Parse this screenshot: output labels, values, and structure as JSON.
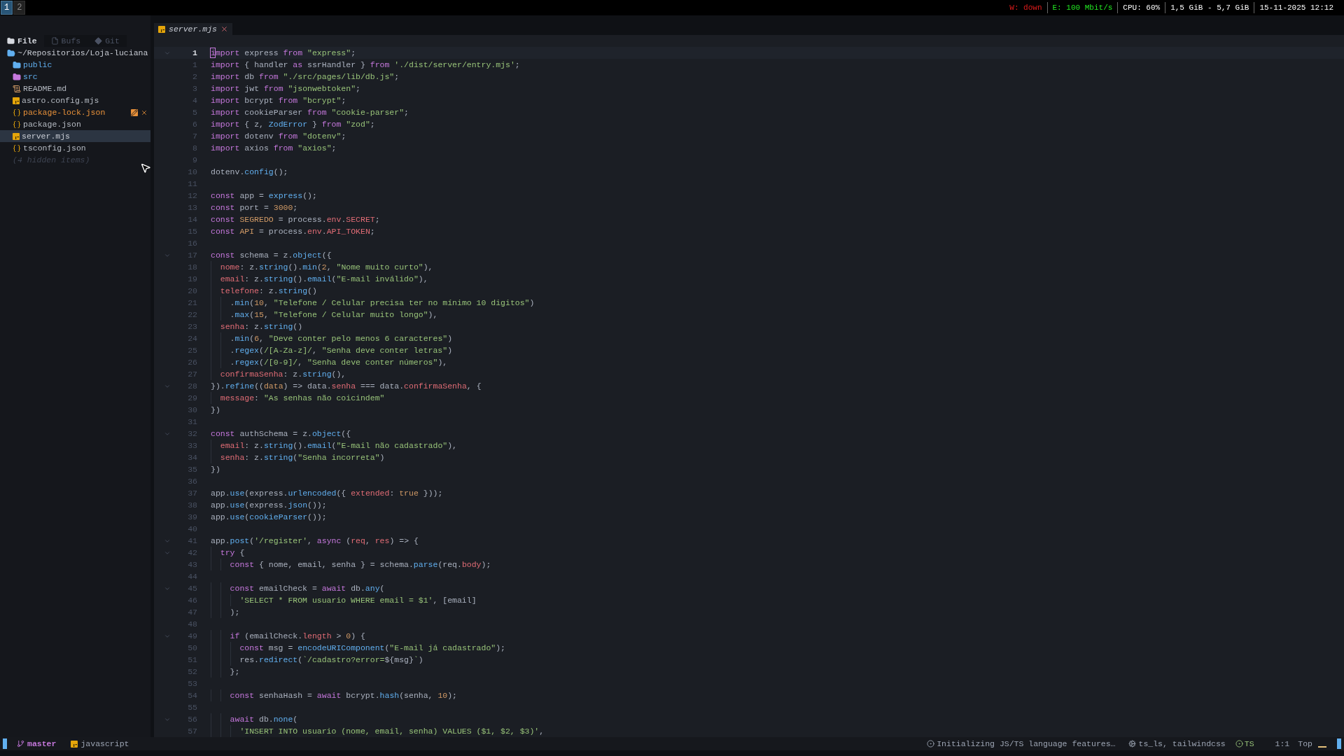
{
  "workspaces": [
    {
      "label": "1",
      "selected": true
    },
    {
      "label": "2",
      "selected": false
    }
  ],
  "system_status": [
    {
      "text": "W: down",
      "color": "#e01b1b"
    },
    {
      "text": "E: 100 Mbit/s",
      "color": "#22e622"
    },
    {
      "text": "CPU: 60%",
      "color": "#ffffff"
    },
    {
      "text": "1,5 GiB - 5,7 GiB",
      "color": "#ffffff"
    },
    {
      "text": "15-11-2025 12:12",
      "color": "#ffffff"
    }
  ],
  "sidebar": {
    "tabs": [
      {
        "label": "File",
        "kind": "folder",
        "selected": true
      },
      {
        "label": "Bufs",
        "kind": "file",
        "selected": false
      },
      {
        "label": "Git",
        "kind": "git",
        "selected": false
      }
    ],
    "tree": [
      {
        "label": "~/Repositorios/Loja-luciana",
        "kind": "root",
        "selected": false,
        "modified": false,
        "children": [
          {
            "label": "public",
            "kind": "folder",
            "selected": false,
            "modified": false
          },
          {
            "label": "src",
            "kind": "src_folder",
            "selected": false,
            "modified": false
          },
          {
            "label": "README.md",
            "kind": "markdown",
            "selected": false,
            "modified": false
          },
          {
            "label": "astro.config.mjs",
            "kind": "js",
            "selected": false,
            "modified": false
          },
          {
            "label": "package-lock.json",
            "kind": "json",
            "selected": false,
            "modified": true
          },
          {
            "label": "package.json",
            "kind": "json",
            "selected": false,
            "modified": false
          },
          {
            "label": "server.mjs",
            "kind": "js",
            "selected": true,
            "modified": false
          },
          {
            "label": "tsconfig.json",
            "kind": "json",
            "selected": false,
            "modified": false
          }
        ]
      }
    ],
    "hidden_note": "(4 hidden items)"
  },
  "editor_tabs": [
    {
      "label": "server.mjs",
      "selected": true
    }
  ],
  "lines": [
    {
      "num": "1",
      "fold": true,
      "current": true,
      "tokens": [
        {
          "kind": "keyword",
          "text": "import"
        },
        {
          "kind": "plain",
          "text": " express "
        },
        {
          "kind": "keyword",
          "text": "from"
        },
        {
          "kind": "string",
          "text": " \"express\""
        },
        {
          "kind": "plain",
          "text": ";"
        }
      ]
    },
    {
      "num": "1",
      "fold": false,
      "current": false,
      "tokens": [
        {
          "kind": "keyword",
          "text": "import"
        },
        {
          "kind": "plain",
          "text": " { handler "
        },
        {
          "kind": "keyword",
          "text": "as"
        },
        {
          "kind": "plain",
          "text": " ssrHandler } "
        },
        {
          "kind": "keyword",
          "text": "from"
        },
        {
          "kind": "string",
          "text": " './dist/server/entry.mjs'"
        },
        {
          "kind": "plain",
          "text": ";"
        }
      ]
    },
    {
      "num": "2",
      "fold": false,
      "current": false,
      "tokens": [
        {
          "kind": "keyword",
          "text": "import"
        },
        {
          "kind": "plain",
          "text": " db "
        },
        {
          "kind": "keyword",
          "text": "from"
        },
        {
          "kind": "string",
          "text": " \"./src/pages/lib/db.js\""
        },
        {
          "kind": "plain",
          "text": ";"
        }
      ]
    },
    {
      "num": "3",
      "fold": false,
      "current": false,
      "tokens": [
        {
          "kind": "keyword",
          "text": "import"
        },
        {
          "kind": "plain",
          "text": " jwt "
        },
        {
          "kind": "keyword",
          "text": "from"
        },
        {
          "kind": "string",
          "text": " \"jsonwebtoken\""
        },
        {
          "kind": "plain",
          "text": ";"
        }
      ]
    },
    {
      "num": "4",
      "fold": false,
      "current": false,
      "tokens": [
        {
          "kind": "keyword",
          "text": "import"
        },
        {
          "kind": "plain",
          "text": " bcrypt "
        },
        {
          "kind": "keyword",
          "text": "from"
        },
        {
          "kind": "string",
          "text": " \"bcrypt\""
        },
        {
          "kind": "plain",
          "text": ";"
        }
      ]
    },
    {
      "num": "5",
      "fold": false,
      "current": false,
      "tokens": [
        {
          "kind": "keyword",
          "text": "import"
        },
        {
          "kind": "plain",
          "text": " cookieParser "
        },
        {
          "kind": "keyword",
          "text": "from"
        },
        {
          "kind": "string",
          "text": " \"cookie-parser\""
        },
        {
          "kind": "plain",
          "text": ";"
        }
      ]
    },
    {
      "num": "6",
      "fold": false,
      "current": false,
      "tokens": [
        {
          "kind": "keyword",
          "text": "import"
        },
        {
          "kind": "plain",
          "text": " { z, "
        },
        {
          "kind": "type",
          "text": "ZodError"
        },
        {
          "kind": "plain",
          "text": " } "
        },
        {
          "kind": "keyword",
          "text": "from"
        },
        {
          "kind": "string",
          "text": " \"zod\""
        },
        {
          "kind": "plain",
          "text": ";"
        }
      ]
    },
    {
      "num": "7",
      "fold": false,
      "current": false,
      "tokens": [
        {
          "kind": "keyword",
          "text": "import"
        },
        {
          "kind": "plain",
          "text": " dotenv "
        },
        {
          "kind": "keyword",
          "text": "from"
        },
        {
          "kind": "string",
          "text": " \"dotenv\""
        },
        {
          "kind": "plain",
          "text": ";"
        }
      ]
    },
    {
      "num": "8",
      "fold": false,
      "current": false,
      "tokens": [
        {
          "kind": "keyword",
          "text": "import"
        },
        {
          "kind": "plain",
          "text": " axios "
        },
        {
          "kind": "keyword",
          "text": "from"
        },
        {
          "kind": "string",
          "text": " \"axios\""
        },
        {
          "kind": "plain",
          "text": ";"
        }
      ]
    },
    {
      "num": "9",
      "fold": false,
      "current": false
    },
    {
      "num": "10",
      "fold": false,
      "current": false,
      "tokens": [
        {
          "kind": "plain",
          "text": "dotenv."
        },
        {
          "kind": "function",
          "text": "config"
        },
        {
          "kind": "plain",
          "text": "();"
        }
      ]
    },
    {
      "num": "11",
      "fold": false,
      "current": false
    },
    {
      "num": "12",
      "fold": false,
      "current": false,
      "tokens": [
        {
          "kind": "keyword",
          "text": "const"
        },
        {
          "kind": "plain",
          "text": " app = "
        },
        {
          "kind": "function",
          "text": "express"
        },
        {
          "kind": "plain",
          "text": "();"
        }
      ]
    },
    {
      "num": "13",
      "fold": false,
      "current": false,
      "tokens": [
        {
          "kind": "keyword",
          "text": "const"
        },
        {
          "kind": "plain",
          "text": " port = "
        },
        {
          "kind": "number",
          "text": "3000"
        },
        {
          "kind": "plain",
          "text": ";"
        }
      ]
    },
    {
      "num": "14",
      "fold": false,
      "current": false,
      "tokens": [
        {
          "kind": "keyword",
          "text": "const"
        },
        {
          "kind": "number",
          "text": " SEGREDO"
        },
        {
          "kind": "plain",
          "text": " = process."
        },
        {
          "kind": "property",
          "text": "env"
        },
        {
          "kind": "plain",
          "text": "."
        },
        {
          "kind": "property",
          "text": "SECRET"
        },
        {
          "kind": "plain",
          "text": ";"
        }
      ]
    },
    {
      "num": "15",
      "fold": false,
      "current": false,
      "tokens": [
        {
          "kind": "keyword",
          "text": "const"
        },
        {
          "kind": "number",
          "text": " API"
        },
        {
          "kind": "plain",
          "text": " = process."
        },
        {
          "kind": "property",
          "text": "env"
        },
        {
          "kind": "plain",
          "text": "."
        },
        {
          "kind": "property",
          "text": "API_TOKEN"
        },
        {
          "kind": "plain",
          "text": ";"
        }
      ]
    },
    {
      "num": "16",
      "fold": false,
      "current": false
    },
    {
      "num": "17",
      "fold": true,
      "current": false,
      "tokens": [
        {
          "kind": "keyword",
          "text": "const"
        },
        {
          "kind": "plain",
          "text": " schema = z."
        },
        {
          "kind": "function",
          "text": "object"
        },
        {
          "kind": "plain",
          "text": "({"
        }
      ]
    },
    {
      "num": "18",
      "fold": false,
      "current": false,
      "tokens": [
        {
          "kind": "property",
          "text": "  nome"
        },
        {
          "kind": "plain",
          "text": ": z."
        },
        {
          "kind": "function",
          "text": "string"
        },
        {
          "kind": "plain",
          "text": "()."
        },
        {
          "kind": "function",
          "text": "min"
        },
        {
          "kind": "plain",
          "text": "("
        },
        {
          "kind": "number",
          "text": "2"
        },
        {
          "kind": "plain",
          "text": ","
        },
        {
          "kind": "string",
          "text": " \"Nome muito curto\""
        },
        {
          "kind": "plain",
          "text": "),"
        }
      ]
    },
    {
      "num": "19",
      "fold": false,
      "current": false,
      "tokens": [
        {
          "kind": "property",
          "text": "  email"
        },
        {
          "kind": "plain",
          "text": ": z."
        },
        {
          "kind": "function",
          "text": "string"
        },
        {
          "kind": "plain",
          "text": "()."
        },
        {
          "kind": "function",
          "text": "email"
        },
        {
          "kind": "plain",
          "text": "("
        },
        {
          "kind": "string",
          "text": "\"E-mail inválido\""
        },
        {
          "kind": "plain",
          "text": "),"
        }
      ]
    },
    {
      "num": "20",
      "fold": false,
      "current": false,
      "tokens": [
        {
          "kind": "property",
          "text": "  telefone"
        },
        {
          "kind": "plain",
          "text": ": z."
        },
        {
          "kind": "function",
          "text": "string"
        },
        {
          "kind": "plain",
          "text": "()"
        }
      ]
    },
    {
      "num": "21",
      "fold": false,
      "current": false,
      "tokens": [
        {
          "kind": "plain",
          "text": "    ."
        },
        {
          "kind": "function",
          "text": "min"
        },
        {
          "kind": "plain",
          "text": "("
        },
        {
          "kind": "number",
          "text": "10"
        },
        {
          "kind": "plain",
          "text": ","
        },
        {
          "kind": "string",
          "text": " \"Telefone / Celular precisa ter no mínimo 10 digitos\""
        },
        {
          "kind": "plain",
          "text": ")"
        }
      ]
    },
    {
      "num": "22",
      "fold": false,
      "current": false,
      "tokens": [
        {
          "kind": "plain",
          "text": "    ."
        },
        {
          "kind": "function",
          "text": "max"
        },
        {
          "kind": "plain",
          "text": "("
        },
        {
          "kind": "number",
          "text": "15"
        },
        {
          "kind": "plain",
          "text": ","
        },
        {
          "kind": "string",
          "text": " \"Telefone / Celular muito longo\""
        },
        {
          "kind": "plain",
          "text": "),"
        }
      ]
    },
    {
      "num": "23",
      "fold": false,
      "current": false,
      "tokens": [
        {
          "kind": "property",
          "text": "  senha"
        },
        {
          "kind": "plain",
          "text": ": z."
        },
        {
          "kind": "function",
          "text": "string"
        },
        {
          "kind": "plain",
          "text": "()"
        }
      ]
    },
    {
      "num": "24",
      "fold": false,
      "current": false,
      "tokens": [
        {
          "kind": "plain",
          "text": "    ."
        },
        {
          "kind": "function",
          "text": "min"
        },
        {
          "kind": "plain",
          "text": "("
        },
        {
          "kind": "number",
          "text": "6"
        },
        {
          "kind": "plain",
          "text": ","
        },
        {
          "kind": "string",
          "text": " \"Deve conter pelo menos 6 caracteres\""
        },
        {
          "kind": "plain",
          "text": ")"
        }
      ]
    },
    {
      "num": "25",
      "fold": false,
      "current": false,
      "tokens": [
        {
          "kind": "plain",
          "text": "    ."
        },
        {
          "kind": "function",
          "text": "regex"
        },
        {
          "kind": "plain",
          "text": "("
        },
        {
          "kind": "string",
          "text": "/[A-Za-z]/"
        },
        {
          "kind": "plain",
          "text": ","
        },
        {
          "kind": "string",
          "text": " \"Senha deve conter letras\""
        },
        {
          "kind": "plain",
          "text": ")"
        }
      ]
    },
    {
      "num": "26",
      "fold": false,
      "current": false,
      "tokens": [
        {
          "kind": "plain",
          "text": "    ."
        },
        {
          "kind": "function",
          "text": "regex"
        },
        {
          "kind": "plain",
          "text": "("
        },
        {
          "kind": "string",
          "text": "/[0-9]/"
        },
        {
          "kind": "plain",
          "text": ","
        },
        {
          "kind": "string",
          "text": " \"Senha deve conter números\""
        },
        {
          "kind": "plain",
          "text": "),"
        }
      ]
    },
    {
      "num": "27",
      "fold": false,
      "current": false,
      "tokens": [
        {
          "kind": "property",
          "text": "  confirmaSenha"
        },
        {
          "kind": "plain",
          "text": ": z."
        },
        {
          "kind": "function",
          "text": "string"
        },
        {
          "kind": "plain",
          "text": "(),"
        }
      ]
    },
    {
      "num": "28",
      "fold": true,
      "current": false,
      "tokens": [
        {
          "kind": "plain",
          "text": "})."
        },
        {
          "kind": "function",
          "text": "refine"
        },
        {
          "kind": "plain",
          "text": "(("
        },
        {
          "kind": "number",
          "text": "data"
        },
        {
          "kind": "plain",
          "text": ") => data."
        },
        {
          "kind": "property",
          "text": "senha"
        },
        {
          "kind": "plain",
          "text": " === data."
        },
        {
          "kind": "property",
          "text": "confirmaSenha"
        },
        {
          "kind": "plain",
          "text": ", {"
        }
      ]
    },
    {
      "num": "29",
      "fold": false,
      "current": false,
      "tokens": [
        {
          "kind": "property",
          "text": "  message"
        },
        {
          "kind": "plain",
          "text": ":"
        },
        {
          "kind": "string",
          "text": " \"As senhas não coicindem\""
        }
      ]
    },
    {
      "num": "30",
      "fold": false,
      "current": false,
      "tokens": [
        {
          "kind": "plain",
          "text": "})"
        }
      ]
    },
    {
      "num": "31",
      "fold": false,
      "current": false
    },
    {
      "num": "32",
      "fold": true,
      "current": false,
      "tokens": [
        {
          "kind": "keyword",
          "text": "const"
        },
        {
          "kind": "plain",
          "text": " authSchema = z."
        },
        {
          "kind": "function",
          "text": "object"
        },
        {
          "kind": "plain",
          "text": "({"
        }
      ]
    },
    {
      "num": "33",
      "fold": false,
      "current": false,
      "tokens": [
        {
          "kind": "property",
          "text": "  email"
        },
        {
          "kind": "plain",
          "text": ": z."
        },
        {
          "kind": "function",
          "text": "string"
        },
        {
          "kind": "plain",
          "text": "()."
        },
        {
          "kind": "function",
          "text": "email"
        },
        {
          "kind": "plain",
          "text": "("
        },
        {
          "kind": "string",
          "text": "\"E-mail não cadastrado\""
        },
        {
          "kind": "plain",
          "text": "),"
        }
      ]
    },
    {
      "num": "34",
      "fold": false,
      "current": false,
      "tokens": [
        {
          "kind": "property",
          "text": "  senha"
        },
        {
          "kind": "plain",
          "text": ": z."
        },
        {
          "kind": "function",
          "text": "string"
        },
        {
          "kind": "plain",
          "text": "("
        },
        {
          "kind": "string",
          "text": "\"Senha incorreta\""
        },
        {
          "kind": "plain",
          "text": ")"
        }
      ]
    },
    {
      "num": "35",
      "fold": false,
      "current": false,
      "tokens": [
        {
          "kind": "plain",
          "text": "})"
        }
      ]
    },
    {
      "num": "36",
      "fold": false,
      "current": false
    },
    {
      "num": "37",
      "fold": false,
      "current": false,
      "tokens": [
        {
          "kind": "plain",
          "text": "app."
        },
        {
          "kind": "function",
          "text": "use"
        },
        {
          "kind": "plain",
          "text": "(express."
        },
        {
          "kind": "function",
          "text": "urlencoded"
        },
        {
          "kind": "plain",
          "text": "({"
        },
        {
          "kind": "property",
          "text": " extended"
        },
        {
          "kind": "plain",
          "text": ":"
        },
        {
          "kind": "number",
          "text": " true"
        },
        {
          "kind": "plain",
          "text": " }));"
        }
      ]
    },
    {
      "num": "38",
      "fold": false,
      "current": false,
      "tokens": [
        {
          "kind": "plain",
          "text": "app."
        },
        {
          "kind": "function",
          "text": "use"
        },
        {
          "kind": "plain",
          "text": "(express."
        },
        {
          "kind": "function",
          "text": "json"
        },
        {
          "kind": "plain",
          "text": "());"
        }
      ]
    },
    {
      "num": "39",
      "fold": false,
      "current": false,
      "tokens": [
        {
          "kind": "plain",
          "text": "app."
        },
        {
          "kind": "function",
          "text": "use"
        },
        {
          "kind": "plain",
          "text": "("
        },
        {
          "kind": "function",
          "text": "cookieParser"
        },
        {
          "kind": "plain",
          "text": "());"
        }
      ]
    },
    {
      "num": "40",
      "fold": false,
      "current": false
    },
    {
      "num": "41",
      "fold": true,
      "current": false,
      "tokens": [
        {
          "kind": "plain",
          "text": "app."
        },
        {
          "kind": "function",
          "text": "post"
        },
        {
          "kind": "plain",
          "text": "("
        },
        {
          "kind": "string",
          "text": "'/register'"
        },
        {
          "kind": "plain",
          "text": ","
        },
        {
          "kind": "keyword",
          "text": " async"
        },
        {
          "kind": "plain",
          "text": " ("
        },
        {
          "kind": "property",
          "text": "req"
        },
        {
          "kind": "plain",
          "text": ","
        },
        {
          "kind": "property",
          "text": " res"
        },
        {
          "kind": "plain",
          "text": ") => {"
        }
      ]
    },
    {
      "num": "42",
      "fold": true,
      "current": false,
      "tokens": [
        {
          "kind": "keyword",
          "text": "  try"
        },
        {
          "kind": "plain",
          "text": " {"
        }
      ]
    },
    {
      "num": "43",
      "fold": false,
      "current": false,
      "tokens": [
        {
          "kind": "keyword",
          "text": "    const"
        },
        {
          "kind": "plain",
          "text": " { nome, email, senha } = schema."
        },
        {
          "kind": "function",
          "text": "parse"
        },
        {
          "kind": "plain",
          "text": "(req."
        },
        {
          "kind": "property",
          "text": "body"
        },
        {
          "kind": "plain",
          "text": ");"
        }
      ]
    },
    {
      "num": "44",
      "fold": false,
      "current": false
    },
    {
      "num": "45",
      "fold": true,
      "current": false,
      "tokens": [
        {
          "kind": "keyword",
          "text": "    const"
        },
        {
          "kind": "plain",
          "text": " emailCheck ="
        },
        {
          "kind": "keyword",
          "text": " await"
        },
        {
          "kind": "plain",
          "text": " db."
        },
        {
          "kind": "function",
          "text": "any"
        },
        {
          "kind": "plain",
          "text": "("
        }
      ]
    },
    {
      "num": "46",
      "fold": false,
      "current": false,
      "tokens": [
        {
          "kind": "string",
          "text": "      'SELECT * FROM usuario WHERE email = $1'"
        },
        {
          "kind": "plain",
          "text": ", [email]"
        }
      ]
    },
    {
      "num": "47",
      "fold": false,
      "current": false,
      "tokens": [
        {
          "kind": "plain",
          "text": "    );"
        }
      ]
    },
    {
      "num": "48",
      "fold": false,
      "current": false
    },
    {
      "num": "49",
      "fold": true,
      "current": false,
      "tokens": [
        {
          "kind": "keyword",
          "text": "    if"
        },
        {
          "kind": "plain",
          "text": " (emailCheck."
        },
        {
          "kind": "property",
          "text": "length"
        },
        {
          "kind": "plain",
          "text": " >"
        },
        {
          "kind": "number",
          "text": " 0"
        },
        {
          "kind": "plain",
          "text": ") {"
        }
      ]
    },
    {
      "num": "50",
      "fold": false,
      "current": false,
      "tokens": [
        {
          "kind": "keyword",
          "text": "      const"
        },
        {
          "kind": "plain",
          "text": " msg ="
        },
        {
          "kind": "function",
          "text": " encodeURIComponent"
        },
        {
          "kind": "plain",
          "text": "("
        },
        {
          "kind": "string",
          "text": "\"E-mail já cadastrado\""
        },
        {
          "kind": "plain",
          "text": ");"
        }
      ]
    },
    {
      "num": "51",
      "fold": false,
      "current": false,
      "tokens": [
        {
          "kind": "plain",
          "text": "      res."
        },
        {
          "kind": "function",
          "text": "redirect"
        },
        {
          "kind": "plain",
          "text": "("
        },
        {
          "kind": "string",
          "text": "`/cadastro?error="
        },
        {
          "kind": "plain",
          "text": "${msg}"
        },
        {
          "kind": "string",
          "text": "`"
        },
        {
          "kind": "plain",
          "text": ")"
        }
      ]
    },
    {
      "num": "52",
      "fold": false,
      "current": false,
      "tokens": [
        {
          "kind": "plain",
          "text": "    };"
        }
      ]
    },
    {
      "num": "53",
      "fold": false,
      "current": false
    },
    {
      "num": "54",
      "fold": false,
      "current": false,
      "tokens": [
        {
          "kind": "keyword",
          "text": "    const"
        },
        {
          "kind": "plain",
          "text": " senhaHash ="
        },
        {
          "kind": "keyword",
          "text": " await"
        },
        {
          "kind": "plain",
          "text": " bcrypt."
        },
        {
          "kind": "function",
          "text": "hash"
        },
        {
          "kind": "plain",
          "text": "(senha,"
        },
        {
          "kind": "number",
          "text": " 10"
        },
        {
          "kind": "plain",
          "text": ");"
        }
      ]
    },
    {
      "num": "55",
      "fold": false,
      "current": false
    },
    {
      "num": "56",
      "fold": true,
      "current": false,
      "tokens": [
        {
          "kind": "keyword",
          "text": "    await"
        },
        {
          "kind": "plain",
          "text": " db."
        },
        {
          "kind": "function",
          "text": "none"
        },
        {
          "kind": "plain",
          "text": "("
        }
      ]
    },
    {
      "num": "57",
      "fold": false,
      "current": false,
      "tokens": [
        {
          "kind": "string",
          "text": "      'INSERT INTO usuario (nome, email, senha) VALUES ($1, $2, $3)'"
        },
        {
          "kind": "plain",
          "text": ","
        }
      ]
    }
  ],
  "statusline": {
    "branch": "master",
    "filetype": "javascript",
    "progress": "Initializing JS/TS language features…",
    "clients": "ts_ls, tailwindcss",
    "diagnostic": "TS",
    "position": "1:1",
    "scroll": "Top"
  }
}
